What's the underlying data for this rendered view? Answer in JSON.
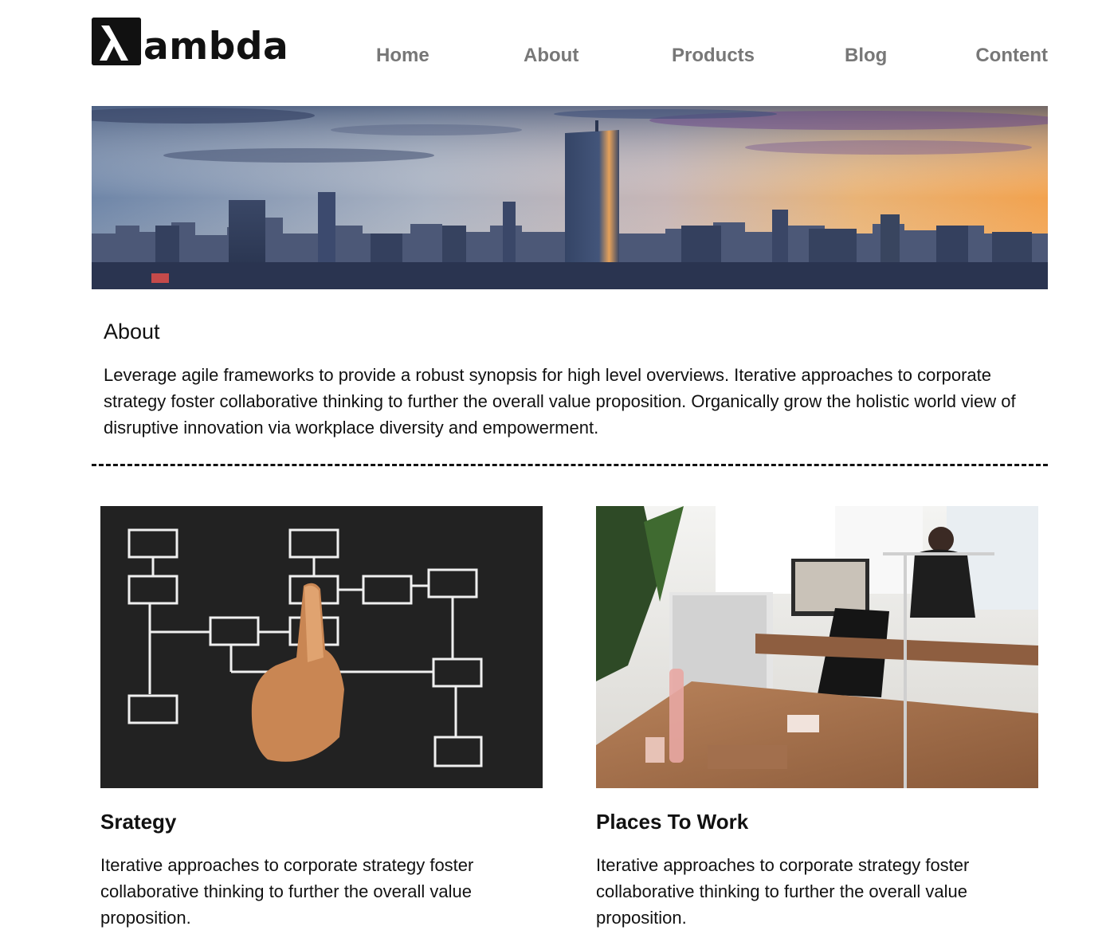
{
  "header": {
    "logo_symbol": "λ",
    "logo_text": "ambda",
    "nav": [
      {
        "label": "Home"
      },
      {
        "label": "About"
      },
      {
        "label": "Products"
      },
      {
        "label": "Blog"
      },
      {
        "label": "Content"
      }
    ]
  },
  "hero": {
    "icon": "city-skyline-image"
  },
  "about": {
    "title": "About",
    "text": "Leverage agile frameworks to provide a robust synopsis for high level overviews. Iterative approaches to corporate strategy foster collaborative thinking to further the overall value proposition. Organically grow the holistic world view of disruptive innovation via workplace diversity and empowerment."
  },
  "cards": [
    {
      "title": "Srategy",
      "text": "Iterative approaches to corporate strategy foster collaborative thinking to further the overall value proposition.",
      "image": "flowchart-chalkboard-image"
    },
    {
      "title": "Places To Work",
      "text": "Iterative approaches to corporate strategy foster collaborative thinking to further the overall value proposition.",
      "image": "office-workspace-image"
    }
  ],
  "colors": {
    "nav_text": "#777777",
    "text": "#111111",
    "background": "#ffffff"
  }
}
